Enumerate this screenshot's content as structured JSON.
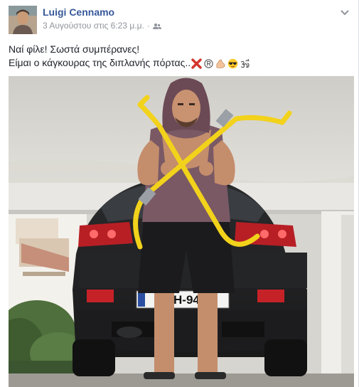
{
  "post": {
    "author_name": "Luigi Cennamo",
    "timestamp": "3 Αυγούστου στις 6:23 μ.μ.",
    "separator": "·",
    "audience_icon": "friends-icon",
    "menu_icon": "chevron-down-icon",
    "text_line1": "Ναί φίλε! Σωστά συμπέρανες!",
    "text_line2": "Είμαι ο κάγκουρας της διπλανής πόρτας..",
    "emojis": [
      "cross-mark-icon",
      "registered-icon",
      "flexed-biceps-icon",
      "sunglasses-face-icon",
      "om-symbol-icon"
    ],
    "photo": {
      "description_icon": "post-photo",
      "license_plate": "Η-946"
    }
  },
  "colors": {
    "author_link": "#365899",
    "meta_text": "#90949c",
    "body_text": "#1d2129",
    "yellow_tool": "#f2d21b"
  }
}
